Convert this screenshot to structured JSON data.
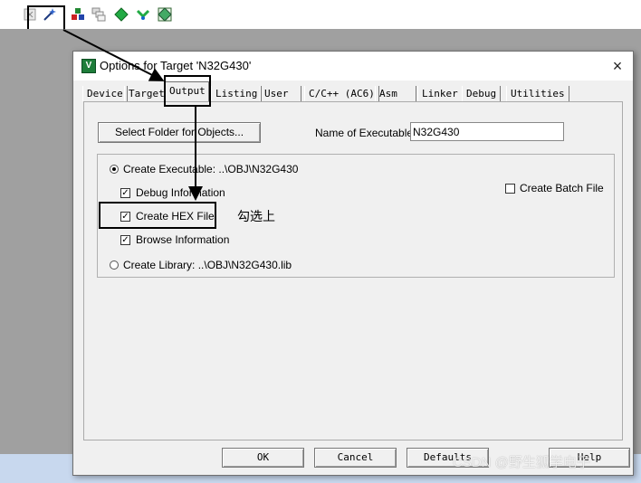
{
  "toolbar": {
    "icons": [
      "translate-icon",
      "magic-wand-icon",
      "download-icon",
      "layers-icon",
      "diamond-icon",
      "pin-icon",
      "grid-icon"
    ]
  },
  "dialog": {
    "title": "Options for Target 'N32G430'",
    "close": "×",
    "app_icon": "V",
    "tabs": [
      "Device",
      "Target",
      "Output",
      "Listing",
      "User",
      "C/C++ (AC6)",
      "Asm",
      "Linker",
      "Debug",
      "Utilities"
    ],
    "active_tab": "Output",
    "select_folder_label": "Select Folder for Objects...",
    "name_of_executable_label": "Name of Executable:",
    "name_of_executable_value": "N32G430",
    "create_executable_label": "Create Executable:  ..\\OBJ\\N32G430",
    "debug_information_label": "Debug Information",
    "create_hex_label": "Create HEX File",
    "browse_information_label": "Browse Information",
    "create_library_label": "Create Library:  ..\\OBJ\\N32G430.lib",
    "create_batch_label": "Create Batch File",
    "checked": {
      "debug_information": true,
      "create_hex": true,
      "browse_information": true,
      "create_batch": false
    },
    "ok_label": "OK",
    "cancel_label": "Cancel",
    "defaults_label": "Defaults",
    "help_label": "Help"
  },
  "annotation": "勾选上",
  "watermark": "CSDN @野生狐学电子"
}
